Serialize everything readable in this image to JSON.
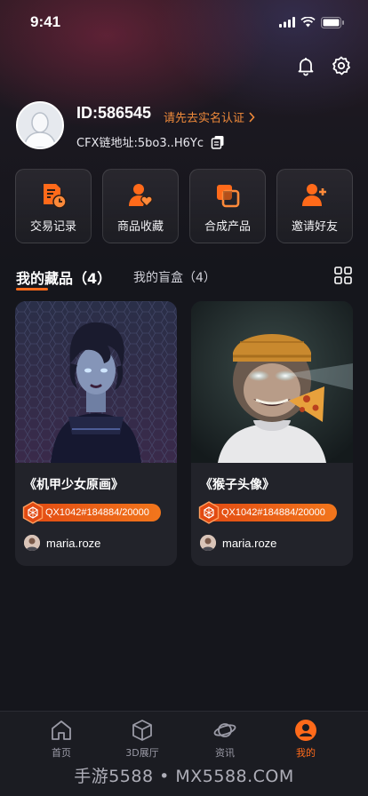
{
  "status_bar": {
    "time": "9:41"
  },
  "profile": {
    "user_id": "ID:586545",
    "verify_link": "请先去实名认证",
    "address": "CFX链地址:5bo3..H6Yc"
  },
  "quick_actions": [
    {
      "label": "交易记录",
      "icon": "transaction-record-icon"
    },
    {
      "label": "商品收藏",
      "icon": "favorites-icon"
    },
    {
      "label": "合成产品",
      "icon": "compose-icon"
    },
    {
      "label": "邀请好友",
      "icon": "invite-friend-icon"
    }
  ],
  "tabs": {
    "active": "我的藏品（4）",
    "inactive": "我的盲盒（4）"
  },
  "cards": [
    {
      "title": "《机甲少女原画》",
      "serial": "QX1042#184884/20000",
      "owner": "maria.roze"
    },
    {
      "title": "《猴子头像》",
      "serial": "QX1042#184884/20000",
      "owner": "maria.roze"
    }
  ],
  "bottom_nav": [
    {
      "label": "首页",
      "icon": "home-icon"
    },
    {
      "label": "3D展厅",
      "icon": "cube-icon"
    },
    {
      "label": "资讯",
      "icon": "planet-icon"
    },
    {
      "label": "我的",
      "icon": "profile-icon"
    }
  ],
  "watermark": "手游5588 • MX5588.COM",
  "colors": {
    "accent": "#ff6a1a",
    "verify": "#f08a3a",
    "card_bg": "#22232a",
    "page_bg": "#15161c"
  }
}
